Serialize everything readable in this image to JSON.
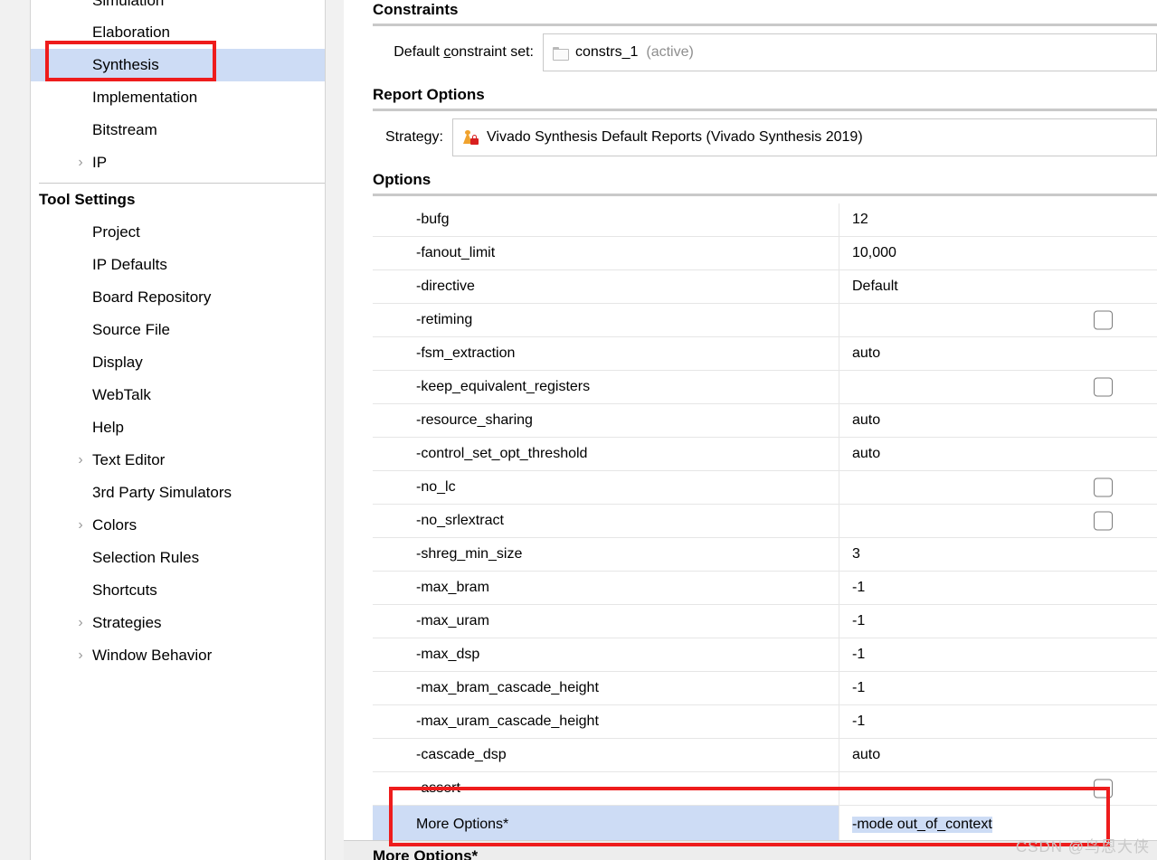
{
  "sidebar": {
    "tree": [
      {
        "label": "Simulation",
        "indent": 2,
        "arrow": "",
        "selected": false,
        "clipped": true
      },
      {
        "label": "Elaboration",
        "indent": 2,
        "arrow": "",
        "selected": false
      },
      {
        "label": "Synthesis",
        "indent": 2,
        "arrow": "",
        "selected": true
      },
      {
        "label": "Implementation",
        "indent": 2,
        "arrow": "",
        "selected": false
      },
      {
        "label": "Bitstream",
        "indent": 2,
        "arrow": "",
        "selected": false
      },
      {
        "label": "IP",
        "indent": 2,
        "arrow": "›",
        "selected": false
      }
    ],
    "tool_settings_title": "Tool Settings",
    "tool_settings": [
      {
        "label": "Project",
        "arrow": ""
      },
      {
        "label": "IP Defaults",
        "arrow": ""
      },
      {
        "label": "Board Repository",
        "arrow": ""
      },
      {
        "label": "Source File",
        "arrow": ""
      },
      {
        "label": "Display",
        "arrow": ""
      },
      {
        "label": "WebTalk",
        "arrow": ""
      },
      {
        "label": "Help",
        "arrow": ""
      },
      {
        "label": "Text Editor",
        "arrow": "›"
      },
      {
        "label": "3rd Party Simulators",
        "arrow": ""
      },
      {
        "label": "Colors",
        "arrow": "›"
      },
      {
        "label": "Selection Rules",
        "arrow": ""
      },
      {
        "label": "Shortcuts",
        "arrow": ""
      },
      {
        "label": "Strategies",
        "arrow": "›"
      },
      {
        "label": "Window Behavior",
        "arrow": "›"
      }
    ]
  },
  "content": {
    "constraints": {
      "heading": "Constraints",
      "field_label_pre": "Default ",
      "field_label_underlined": "c",
      "field_label_post": "onstraint set:",
      "value": "constrs_1",
      "value_suffix": "(active)",
      "icon": "folder-icon"
    },
    "report_options": {
      "heading": "Report Options",
      "field_label": "Strategy:",
      "value": "Vivado Synthesis Default Reports (Vivado Synthesis 2019)",
      "icon": "strategy-locked-icon"
    },
    "options": {
      "heading": "Options",
      "rows": [
        {
          "name": "-bufg",
          "value": "12",
          "type": "text"
        },
        {
          "name": "-fanout_limit",
          "value": "10,000",
          "type": "text"
        },
        {
          "name": "-directive",
          "value": "Default",
          "type": "text"
        },
        {
          "name": "-retiming",
          "value": "",
          "type": "checkbox",
          "checked": false
        },
        {
          "name": "-fsm_extraction",
          "value": "auto",
          "type": "text"
        },
        {
          "name": "-keep_equivalent_registers",
          "value": "",
          "type": "checkbox",
          "checked": false
        },
        {
          "name": "-resource_sharing",
          "value": "auto",
          "type": "text"
        },
        {
          "name": "-control_set_opt_threshold",
          "value": "auto",
          "type": "text"
        },
        {
          "name": "-no_lc",
          "value": "",
          "type": "checkbox",
          "checked": false
        },
        {
          "name": "-no_srlextract",
          "value": "",
          "type": "checkbox",
          "checked": false
        },
        {
          "name": "-shreg_min_size",
          "value": "3",
          "type": "text"
        },
        {
          "name": "-max_bram",
          "value": "-1",
          "type": "text"
        },
        {
          "name": "-max_uram",
          "value": "-1",
          "type": "text"
        },
        {
          "name": "-max_dsp",
          "value": "-1",
          "type": "text"
        },
        {
          "name": "-max_bram_cascade_height",
          "value": "-1",
          "type": "text"
        },
        {
          "name": "-max_uram_cascade_height",
          "value": "-1",
          "type": "text"
        },
        {
          "name": "-cascade_dsp",
          "value": "auto",
          "type": "text"
        },
        {
          "name": "-assert",
          "value": "",
          "type": "checkbox",
          "checked": false
        },
        {
          "name": "More Options*",
          "value": "-mode out_of_context",
          "type": "text",
          "selected": true
        }
      ]
    },
    "bottom_heading": "More Options*"
  },
  "watermark": "CSDN @鸟恩大侠",
  "colors": {
    "selection_blue": "#cddcf5",
    "annotation_red": "#ee1c1c",
    "panel_white": "#ffffff",
    "page_grey": "#f1f1f1",
    "rule_grey": "#c9c9c9",
    "muted_text": "#8e8e8e"
  }
}
